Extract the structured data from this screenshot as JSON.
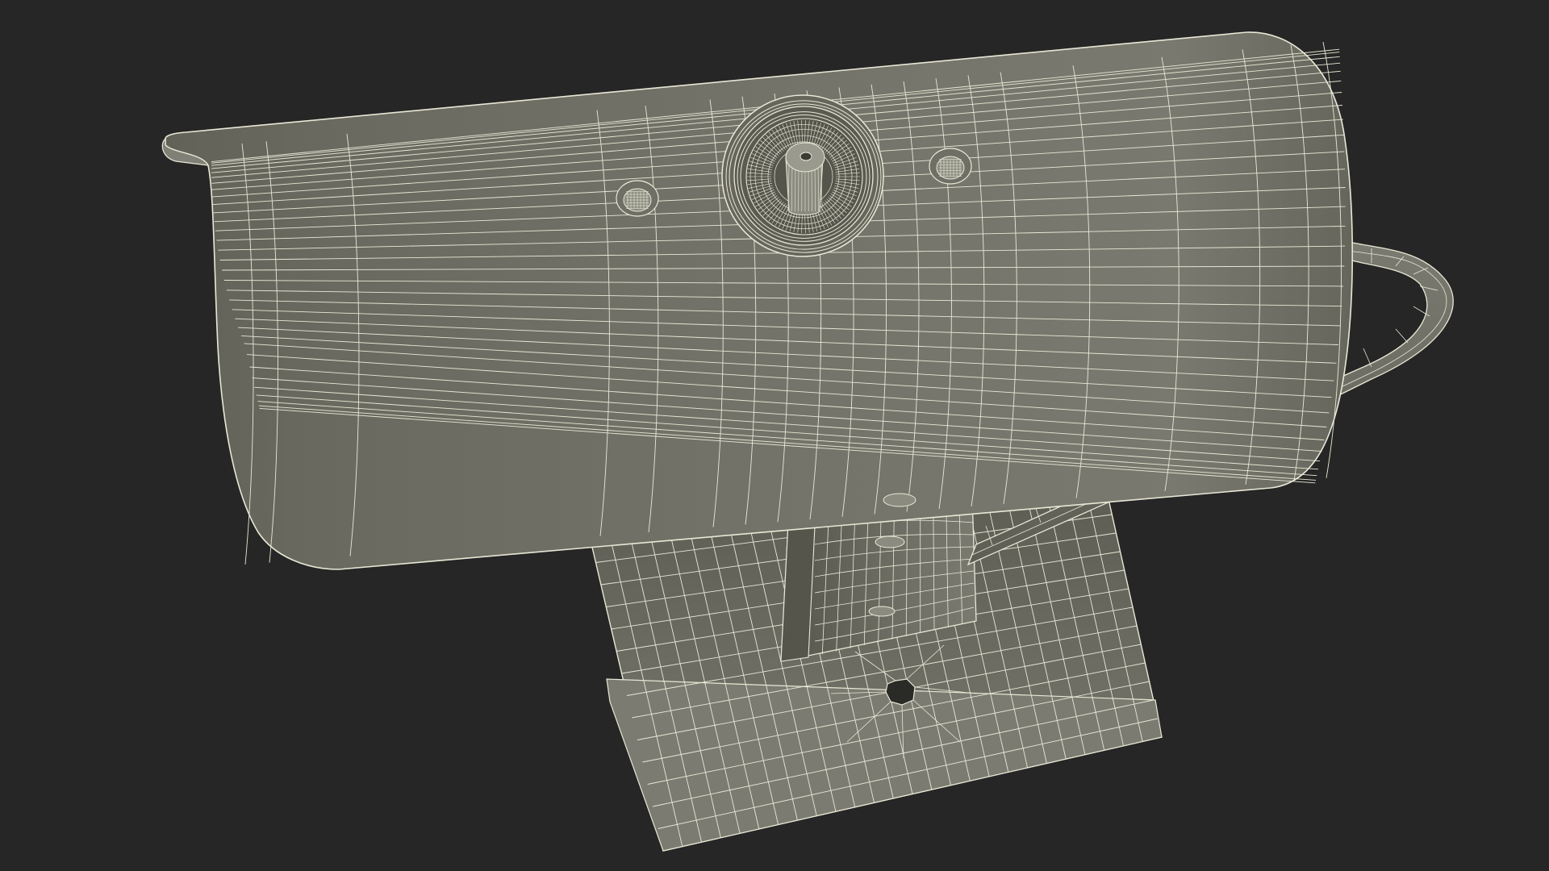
{
  "scene": {
    "subject": "webcam-wireframe-model",
    "colors": {
      "background": "#262626",
      "surface_dark": "#5f5f55",
      "surface_mid": "#6d6d63",
      "surface_light": "#7d7d73",
      "wire": "#e9e8d6",
      "hole": "#2a2a26"
    }
  }
}
